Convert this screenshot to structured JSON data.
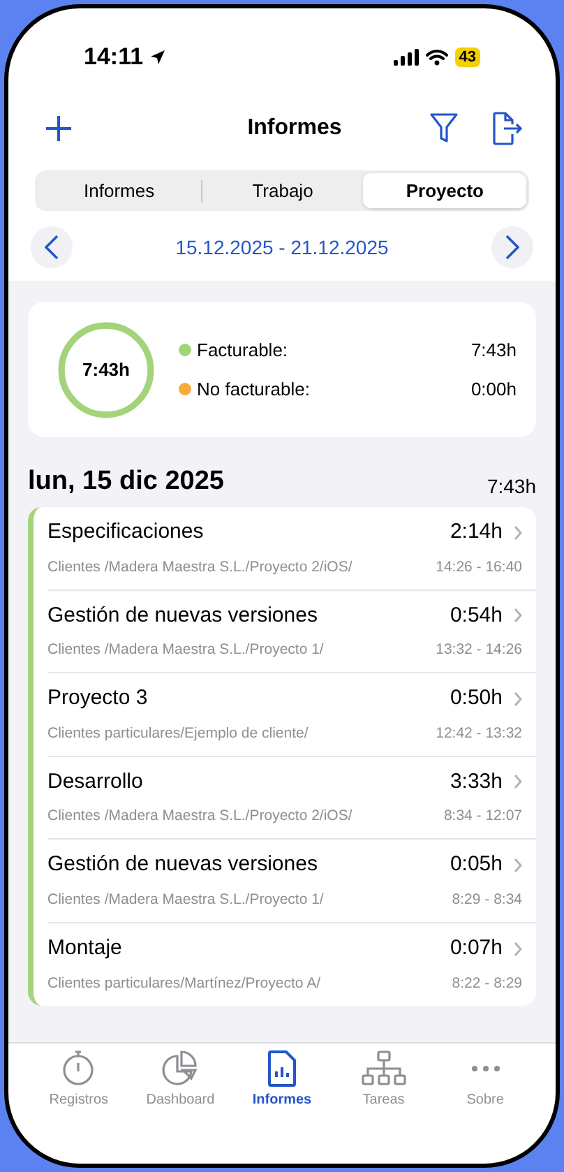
{
  "status_bar": {
    "time": "14:11",
    "battery": "43"
  },
  "nav": {
    "title": "Informes"
  },
  "tabs": [
    {
      "label": "Informes",
      "selected": false
    },
    {
      "label": "Trabajo",
      "selected": false
    },
    {
      "label": "Proyecto",
      "selected": true
    }
  ],
  "date_range": "15.12.2025 - 21.12.2025",
  "summary": {
    "total": "7:43h",
    "level": 1,
    "legend": [
      {
        "label": "Facturable:",
        "value": "7:43h",
        "color": "#a3d47a"
      },
      {
        "label": "No facturable:",
        "value": "0:00h",
        "color": "#f5ab3c"
      }
    ]
  },
  "day": {
    "title": "lun, 15 dic 2025",
    "total": "7:43h"
  },
  "entries": [
    {
      "title": "Especificaciones",
      "duration": "2:14h",
      "path": "Clientes /Madera Maestra S.L./Proyecto 2/iOS/",
      "time": "14:26 - 16:40"
    },
    {
      "title": "Gestión de nuevas versiones",
      "duration": "0:54h",
      "path": "Clientes /Madera Maestra S.L./Proyecto 1/",
      "time": "13:32 - 14:26"
    },
    {
      "title": "Proyecto 3",
      "duration": "0:50h",
      "path": "Clientes particulares/Ejemplo de cliente/",
      "time": "12:42 - 13:32"
    },
    {
      "title": "Desarrollo",
      "duration": "3:33h",
      "path": "Clientes /Madera Maestra S.L./Proyecto 2/iOS/",
      "time": "8:34 - 12:07"
    },
    {
      "title": "Gestión de nuevas versiones",
      "duration": "0:05h",
      "path": "Clientes /Madera Maestra S.L./Proyecto 1/",
      "time": "8:29 - 8:34"
    },
    {
      "title": "Montaje",
      "duration": "0:07h",
      "path": "Clientes particulares/Martínez/Proyecto A/",
      "time": "8:22 - 8:29"
    }
  ],
  "tab_bar": [
    {
      "label": "Registros",
      "kind": "stopwatch",
      "selected": false
    },
    {
      "label": "Dashboard",
      "kind": "pie",
      "selected": false
    },
    {
      "label": "Informes",
      "kind": "report",
      "selected": true
    },
    {
      "label": "Tareas",
      "kind": "tree",
      "selected": false
    },
    {
      "label": "Sobre",
      "kind": "more",
      "selected": false
    }
  ]
}
